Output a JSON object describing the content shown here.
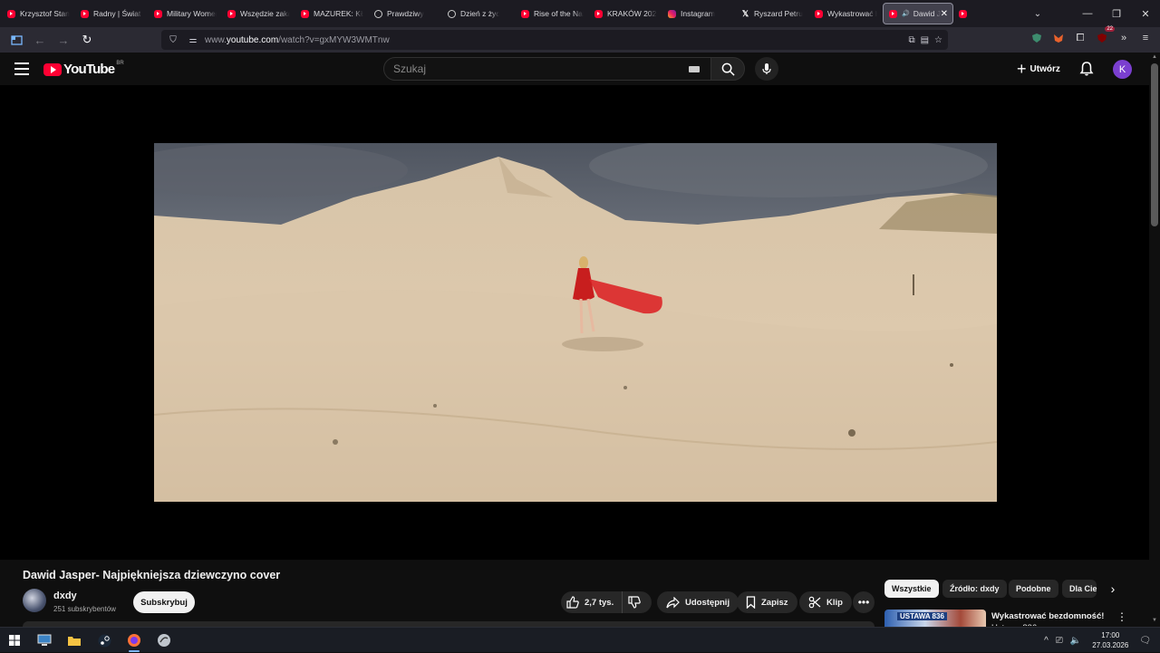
{
  "browser": {
    "tabs": [
      {
        "label": "Krzysztof Stanc",
        "icon": "youtube"
      },
      {
        "label": "Radny | Świat w",
        "icon": "youtube"
      },
      {
        "label": "Military Women",
        "icon": "youtube"
      },
      {
        "label": "Wszędzie zakaz",
        "icon": "youtube"
      },
      {
        "label": "MAZUREK: KŁO",
        "icon": "youtube"
      },
      {
        "label": "Prawdziwy",
        "icon": "circle"
      },
      {
        "label": "Dzień z życ",
        "icon": "circle"
      },
      {
        "label": "Rise of the Naz",
        "icon": "youtube"
      },
      {
        "label": "KRAKÓW 2026",
        "icon": "youtube"
      },
      {
        "label": "Instagram",
        "icon": "instagram"
      },
      {
        "label": "Ryszard Petru",
        "icon": "x"
      },
      {
        "label": "Wykastrować b",
        "icon": "youtube"
      },
      {
        "label": "Dawid J",
        "icon": "youtube",
        "active": true
      },
      {
        "label": "",
        "icon": "youtube"
      }
    ],
    "url_prefix": "www.",
    "url_host": "youtube.com",
    "url_path": "/watch?v=gxMYW3WMTnw",
    "extension_badge": "22"
  },
  "youtube": {
    "logo_text": "YouTube",
    "country_code": "BR",
    "search_placeholder": "Szukaj",
    "create_label": "Utwórz",
    "avatar_letter": "K"
  },
  "video": {
    "title": "Dawid Jasper- Najpiękniejsza dziewczyno cover",
    "channel_name": "dxdy",
    "subscribers": "251 subskrybentów",
    "subscribe_label": "Subskrybuj",
    "likes": "2,7 tys.",
    "share_label": "Udostępnij",
    "save_label": "Zapisz",
    "clip_label": "Klip"
  },
  "chips": [
    "Wszystkie",
    "Źródło: dxdy",
    "Podobne",
    "Dla Ciebie"
  ],
  "recommendation": {
    "thumb_tag": "USTAWA 836",
    "title": "Wykastrować bezdomność!",
    "subtitle": "Ustawa 836"
  },
  "taskbar": {
    "time": "17:00",
    "date": "27.03.2026"
  },
  "colors": {
    "youtube_red": "#ff0033",
    "avatar": "#7b3fd0",
    "background": "#0f0f0f"
  }
}
